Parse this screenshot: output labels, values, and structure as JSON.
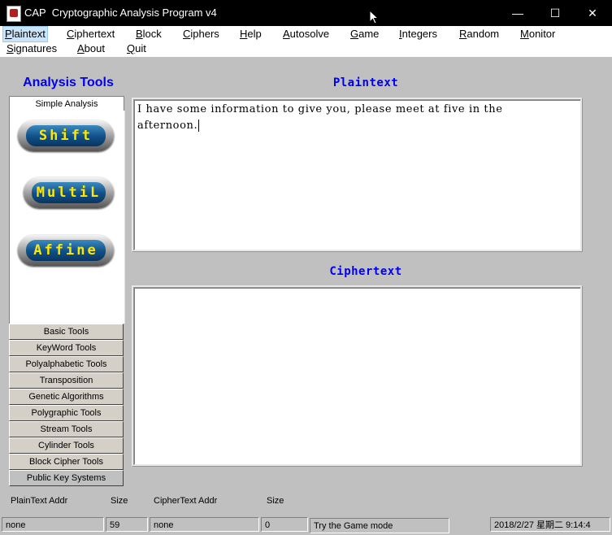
{
  "window": {
    "title": "CAP  Cryptographic Analysis Program v4",
    "minimize": "—",
    "maximize": "☐",
    "close": "✕"
  },
  "menu": [
    {
      "label": "Plaintext",
      "underline": "P",
      "rest": "laintext"
    },
    {
      "label": "Ciphertext",
      "underline": "C",
      "rest": "iphertext"
    },
    {
      "label": "Block",
      "underline": "B",
      "rest": "lock"
    },
    {
      "label": "Ciphers",
      "underline": "C",
      "rest": "iphers"
    },
    {
      "label": "Help",
      "underline": "H",
      "rest": "elp"
    },
    {
      "label": "Autosolve",
      "underline": "A",
      "rest": "utosolve"
    },
    {
      "label": "Game",
      "underline": "G",
      "rest": "ame"
    },
    {
      "label": "Integers",
      "underline": "I",
      "rest": "ntegers"
    },
    {
      "label": "Random",
      "underline": "R",
      "rest": "andom"
    },
    {
      "label": "Monitor",
      "underline": "M",
      "rest": "onitor"
    },
    {
      "label": "Signatures",
      "underline": "S",
      "rest": "ignatures"
    },
    {
      "label": "About",
      "underline": "A",
      "rest": "bout"
    },
    {
      "label": "Quit",
      "underline": "Q",
      "rest": "uit"
    }
  ],
  "sidebar": {
    "title": "Analysis Tools",
    "active_tab": "Simple Analysis",
    "pill_buttons": [
      "Shift",
      "MultiL",
      "Affine"
    ],
    "tools": [
      "Basic Tools",
      "KeyWord Tools",
      "Polyalphabetic Tools",
      "Transposition",
      "Genetic Algorithms",
      "Polygraphic Tools",
      "Stream Tools",
      "Cylinder Tools",
      "Block Cipher Tools",
      "Public Key Systems"
    ]
  },
  "plaintext": {
    "label": "Plaintext",
    "line1": "I have some information to give you, please meet at five in the",
    "line2": "afternoon."
  },
  "ciphertext": {
    "label": "Ciphertext",
    "value": ""
  },
  "status": {
    "plaintext_addr_label": "PlainText Addr",
    "size_label_1": "Size",
    "ciphertext_addr_label": "CipherText Addr",
    "size_label_2": "Size",
    "plaintext_addr": "none",
    "plaintext_size": "59",
    "ciphertext_addr": "none",
    "ciphertext_size": "0",
    "hint": "Try the Game mode",
    "datetime": "2018/2/27 星期二  9:14:4"
  }
}
